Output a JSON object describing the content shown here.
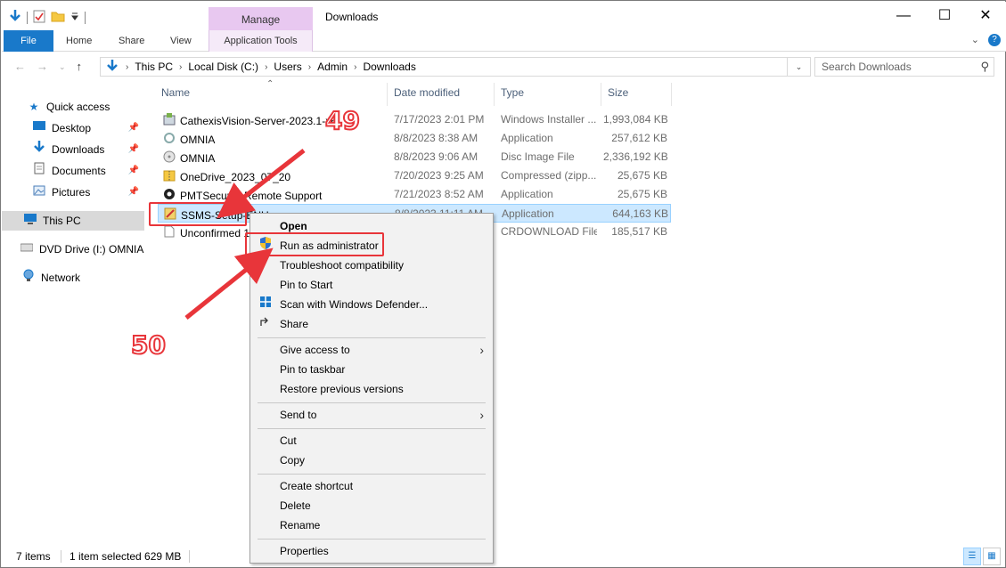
{
  "window": {
    "title": "Downloads",
    "context_tab": "Manage",
    "minimize": "—",
    "maximize": "☐",
    "close": "✕"
  },
  "ribbon": {
    "tabs": [
      "File",
      "Home",
      "Share",
      "View"
    ],
    "app_tools": "Application Tools",
    "expand": "⌄",
    "help": "?"
  },
  "address": {
    "crumbs": [
      "This PC",
      "Local Disk (C:)",
      "Users",
      "Admin",
      "Downloads"
    ],
    "search_placeholder": "Search Downloads"
  },
  "sidebar": {
    "items": [
      {
        "label": "Quick access",
        "icon": "star-icon"
      },
      {
        "label": "Desktop",
        "icon": "desktop-icon"
      },
      {
        "label": "Downloads",
        "icon": "download-icon"
      },
      {
        "label": "Documents",
        "icon": "document-icon"
      },
      {
        "label": "Pictures",
        "icon": "picture-icon"
      },
      {
        "label": "This PC",
        "icon": "computer-icon"
      },
      {
        "label": "DVD Drive (I:) OMNIA",
        "icon": "dvd-icon"
      },
      {
        "label": "Network",
        "icon": "network-icon"
      }
    ]
  },
  "columns": {
    "name": "Name",
    "date": "Date modified",
    "type": "Type",
    "size": "Size"
  },
  "files": [
    {
      "name": "CathexisVision-Server-2023.1-x6",
      "date": "7/17/2023 2:01 PM",
      "type": "Windows Installer ...",
      "size": "1,993,084 KB"
    },
    {
      "name": "OMNIA",
      "date": "8/8/2023 8:38 AM",
      "type": "Application",
      "size": "257,612 KB"
    },
    {
      "name": "OMNIA",
      "date": "8/8/2023 9:06 AM",
      "type": "Disc Image File",
      "size": "2,336,192 KB"
    },
    {
      "name": "OneDrive_2023_07_20",
      "date": "7/20/2023 9:25 AM",
      "type": "Compressed (zipp...",
      "size": "25,675 KB"
    },
    {
      "name": "PMTSecurity Remote Support",
      "date": "7/21/2023 8:52 AM",
      "type": "Application",
      "size": "25,675 KB"
    },
    {
      "name": "SSMS-Setup-ENU",
      "date": "8/8/2023 11:11 AM",
      "type": "Application",
      "size": "644,163 KB"
    },
    {
      "name": "Unconfirmed 1",
      "date": "",
      "type": "CRDOWNLOAD File",
      "size": "185,517 KB"
    }
  ],
  "context_menu": {
    "items": [
      {
        "label": "Open",
        "bold": true
      },
      {
        "label": "Run as administrator",
        "icon": "shield-icon"
      },
      {
        "label": "Troubleshoot compatibility"
      },
      {
        "label": "Pin to Start"
      },
      {
        "label": "Scan with Windows Defender...",
        "icon": "defender-icon"
      },
      {
        "label": "Share",
        "icon": "share-icon"
      },
      {
        "label": "Give access to",
        "submenu": true
      },
      {
        "label": "Pin to taskbar"
      },
      {
        "label": "Restore previous versions"
      },
      {
        "label": "Send to",
        "submenu": true
      },
      {
        "label": "Cut"
      },
      {
        "label": "Copy"
      },
      {
        "label": "Create shortcut"
      },
      {
        "label": "Delete"
      },
      {
        "label": "Rename"
      },
      {
        "label": "Properties"
      }
    ]
  },
  "annotations": {
    "step1": "49",
    "step2": "50",
    "color": "#e8353a"
  },
  "status": {
    "count": "7 items",
    "selected": "1 item selected  629 MB"
  },
  "colors": {
    "accent": "#1979ca",
    "manage_tab": "#e8c8f0",
    "selection": "#cce8ff"
  }
}
